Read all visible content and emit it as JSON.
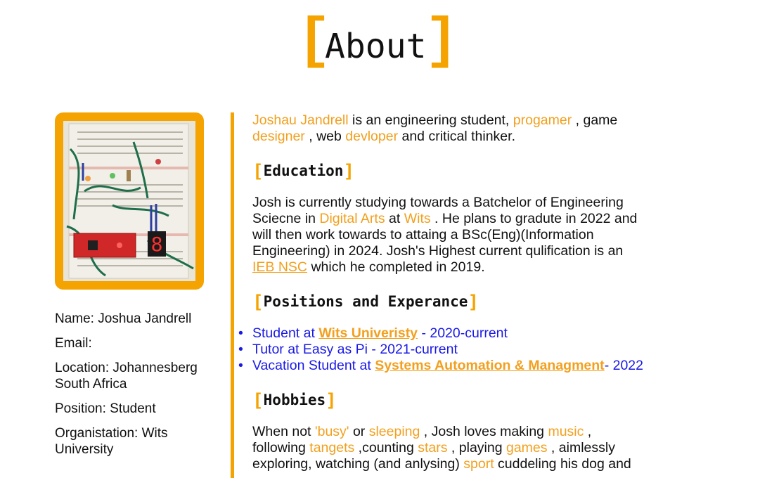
{
  "page": {
    "title": "About",
    "bracket_open": "[",
    "bracket_close": "]"
  },
  "profile": {
    "photo_alt": "breadboard-circuit-photo",
    "name_label": "Name:",
    "name": "Joshua Jandrell",
    "email_label": "Email:",
    "email": "",
    "location_label": "Location:",
    "location": "Johannesberg South Africa",
    "position_label": "Position:",
    "position": "Student",
    "organisation_label": "Organistation:",
    "organisation": "Wits University"
  },
  "intro": {
    "name_link": "Joshau Jandrell",
    "t1": " is an engineering student, ",
    "progamer": "progamer",
    "t2": " , game ",
    "designer": "designer",
    "t3": " , web ",
    "devloper": "devloper",
    "t4": " and critical thinker."
  },
  "education": {
    "heading": "Education",
    "t1": "Josh is currently studying towards a Batchelor of Engineering Sciecne in ",
    "digital_arts": "Digital Arts",
    "t2": " at ",
    "wits": "Wits",
    "t3": " . He plans to gradute in 2022 and will then work towards to attaing a BSc(Eng)(Information Engineering) in 2024. Josh's Highest current qulification is an ",
    "ieb": "IEB NSC",
    "t4": " which he completed in 2019."
  },
  "positions": {
    "heading": "Positions and Experance",
    "items": [
      {
        "pre": "Student at ",
        "link": "Wits Univeristy",
        "post": " - 2020-current"
      },
      {
        "pre": "Tutor at Easy as Pi - 2021-current",
        "link": "",
        "post": ""
      },
      {
        "pre": "Vacation Student at ",
        "link": "Systems Automation & Managment",
        "post": "- 2022"
      }
    ]
  },
  "hobbies": {
    "heading": "Hobbies",
    "t1": "When not ",
    "busy": "'busy'",
    "t2": " or ",
    "sleeping": "sleeping",
    "t3": " , Josh loves making ",
    "music": "music",
    "t4": " , following ",
    "tangets": "tangets",
    "t5": " ,counting ",
    "stars": "stars",
    "t6": " , playing ",
    "games": "games",
    "t7": " , aimlessly exploring, watching (and anlysing) ",
    "sport": "sport",
    "t8": " cuddeling his dog and"
  },
  "colors": {
    "accent": "#f5a300",
    "link_orange": "#f2a01e",
    "list_blue": "#1a1ae6"
  }
}
